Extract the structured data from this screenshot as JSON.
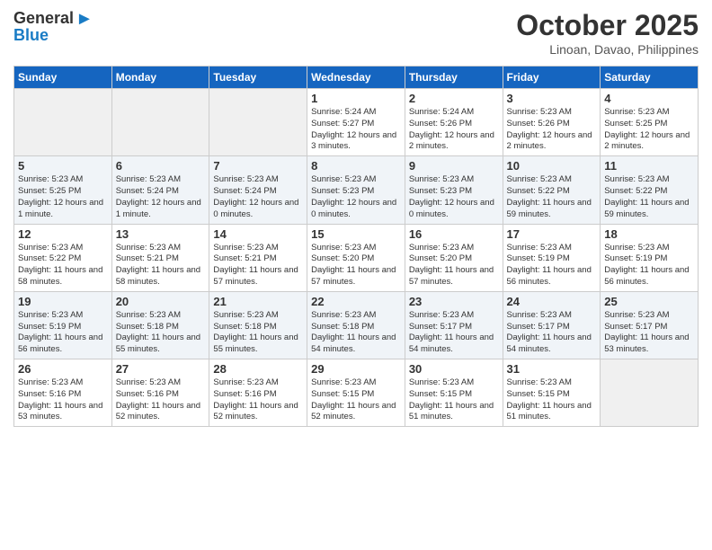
{
  "header": {
    "logo_general": "General",
    "logo_blue": "Blue",
    "month_year": "October 2025",
    "location": "Linoan, Davao, Philippines"
  },
  "weekdays": [
    "Sunday",
    "Monday",
    "Tuesday",
    "Wednesday",
    "Thursday",
    "Friday",
    "Saturday"
  ],
  "weeks": [
    [
      {
        "day": "",
        "sunrise": "",
        "sunset": "",
        "daylight": "",
        "empty": true
      },
      {
        "day": "",
        "sunrise": "",
        "sunset": "",
        "daylight": "",
        "empty": true
      },
      {
        "day": "",
        "sunrise": "",
        "sunset": "",
        "daylight": "",
        "empty": true
      },
      {
        "day": "1",
        "sunrise": "5:24 AM",
        "sunset": "5:27 PM",
        "daylight": "12 hours and 3 minutes."
      },
      {
        "day": "2",
        "sunrise": "5:24 AM",
        "sunset": "5:26 PM",
        "daylight": "12 hours and 2 minutes."
      },
      {
        "day": "3",
        "sunrise": "5:23 AM",
        "sunset": "5:26 PM",
        "daylight": "12 hours and 2 minutes."
      },
      {
        "day": "4",
        "sunrise": "5:23 AM",
        "sunset": "5:25 PM",
        "daylight": "12 hours and 2 minutes."
      }
    ],
    [
      {
        "day": "5",
        "sunrise": "5:23 AM",
        "sunset": "5:25 PM",
        "daylight": "12 hours and 1 minute."
      },
      {
        "day": "6",
        "sunrise": "5:23 AM",
        "sunset": "5:24 PM",
        "daylight": "12 hours and 1 minute."
      },
      {
        "day": "7",
        "sunrise": "5:23 AM",
        "sunset": "5:24 PM",
        "daylight": "12 hours and 0 minutes."
      },
      {
        "day": "8",
        "sunrise": "5:23 AM",
        "sunset": "5:23 PM",
        "daylight": "12 hours and 0 minutes."
      },
      {
        "day": "9",
        "sunrise": "5:23 AM",
        "sunset": "5:23 PM",
        "daylight": "12 hours and 0 minutes."
      },
      {
        "day": "10",
        "sunrise": "5:23 AM",
        "sunset": "5:22 PM",
        "daylight": "11 hours and 59 minutes."
      },
      {
        "day": "11",
        "sunrise": "5:23 AM",
        "sunset": "5:22 PM",
        "daylight": "11 hours and 59 minutes."
      }
    ],
    [
      {
        "day": "12",
        "sunrise": "5:23 AM",
        "sunset": "5:22 PM",
        "daylight": "11 hours and 58 minutes."
      },
      {
        "day": "13",
        "sunrise": "5:23 AM",
        "sunset": "5:21 PM",
        "daylight": "11 hours and 58 minutes."
      },
      {
        "day": "14",
        "sunrise": "5:23 AM",
        "sunset": "5:21 PM",
        "daylight": "11 hours and 57 minutes."
      },
      {
        "day": "15",
        "sunrise": "5:23 AM",
        "sunset": "5:20 PM",
        "daylight": "11 hours and 57 minutes."
      },
      {
        "day": "16",
        "sunrise": "5:23 AM",
        "sunset": "5:20 PM",
        "daylight": "11 hours and 57 minutes."
      },
      {
        "day": "17",
        "sunrise": "5:23 AM",
        "sunset": "5:19 PM",
        "daylight": "11 hours and 56 minutes."
      },
      {
        "day": "18",
        "sunrise": "5:23 AM",
        "sunset": "5:19 PM",
        "daylight": "11 hours and 56 minutes."
      }
    ],
    [
      {
        "day": "19",
        "sunrise": "5:23 AM",
        "sunset": "5:19 PM",
        "daylight": "11 hours and 56 minutes."
      },
      {
        "day": "20",
        "sunrise": "5:23 AM",
        "sunset": "5:18 PM",
        "daylight": "11 hours and 55 minutes."
      },
      {
        "day": "21",
        "sunrise": "5:23 AM",
        "sunset": "5:18 PM",
        "daylight": "11 hours and 55 minutes."
      },
      {
        "day": "22",
        "sunrise": "5:23 AM",
        "sunset": "5:18 PM",
        "daylight": "11 hours and 54 minutes."
      },
      {
        "day": "23",
        "sunrise": "5:23 AM",
        "sunset": "5:17 PM",
        "daylight": "11 hours and 54 minutes."
      },
      {
        "day": "24",
        "sunrise": "5:23 AM",
        "sunset": "5:17 PM",
        "daylight": "11 hours and 54 minutes."
      },
      {
        "day": "25",
        "sunrise": "5:23 AM",
        "sunset": "5:17 PM",
        "daylight": "11 hours and 53 minutes."
      }
    ],
    [
      {
        "day": "26",
        "sunrise": "5:23 AM",
        "sunset": "5:16 PM",
        "daylight": "11 hours and 53 minutes."
      },
      {
        "day": "27",
        "sunrise": "5:23 AM",
        "sunset": "5:16 PM",
        "daylight": "11 hours and 52 minutes."
      },
      {
        "day": "28",
        "sunrise": "5:23 AM",
        "sunset": "5:16 PM",
        "daylight": "11 hours and 52 minutes."
      },
      {
        "day": "29",
        "sunrise": "5:23 AM",
        "sunset": "5:15 PM",
        "daylight": "11 hours and 52 minutes."
      },
      {
        "day": "30",
        "sunrise": "5:23 AM",
        "sunset": "5:15 PM",
        "daylight": "11 hours and 51 minutes."
      },
      {
        "day": "31",
        "sunrise": "5:23 AM",
        "sunset": "5:15 PM",
        "daylight": "11 hours and 51 minutes."
      },
      {
        "day": "",
        "sunrise": "",
        "sunset": "",
        "daylight": "",
        "empty": true
      }
    ]
  ],
  "labels": {
    "sunrise_prefix": "Sunrise: ",
    "sunset_prefix": "Sunset: ",
    "daylight_prefix": "Daylight: "
  }
}
